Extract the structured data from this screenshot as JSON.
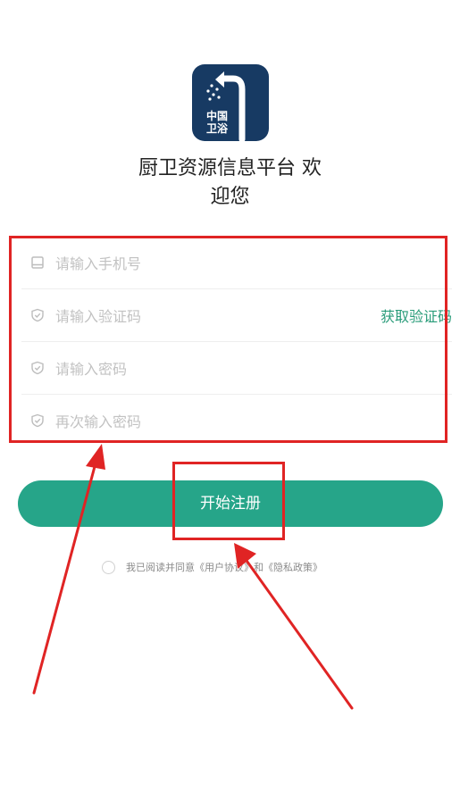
{
  "logo": {
    "line1": "中国",
    "line2": "卫浴"
  },
  "title": {
    "line1": "厨卫资源信息平台 欢",
    "line2": "迎您"
  },
  "form": {
    "phone_placeholder": "请输入手机号",
    "code_placeholder": "请输入验证码",
    "get_code_label": "获取验证码",
    "password_placeholder": "请输入密码",
    "confirm_password_placeholder": "再次输入密码"
  },
  "register_button_label": "开始注册",
  "agreement": {
    "text": "我已阅读并同意《用户协议》和《隐私政策》"
  },
  "colors": {
    "accent": "#26a589",
    "link": "#2a9c7a",
    "annotation_red": "#e02424",
    "logo_bg": "#173a63"
  },
  "icons": [
    "phone-icon",
    "shield-icon",
    "logo-shower-icon"
  ]
}
